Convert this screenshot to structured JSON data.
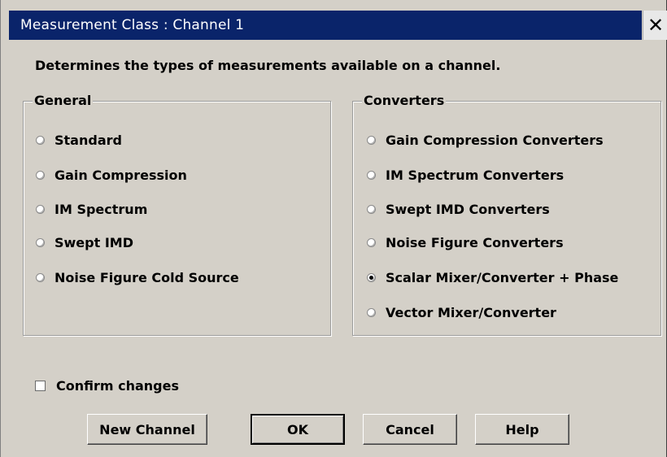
{
  "window": {
    "title": "Measurement Class : Channel 1",
    "close_glyph": "✕"
  },
  "description": "Determines the types of measurements available on a channel.",
  "groups": {
    "general": {
      "legend": "General",
      "options": [
        {
          "label": "Standard",
          "selected": false
        },
        {
          "label": "Gain Compression",
          "selected": false
        },
        {
          "label": "IM Spectrum",
          "selected": false
        },
        {
          "label": "Swept IMD",
          "selected": false
        },
        {
          "label": "Noise Figure Cold Source",
          "selected": false
        }
      ]
    },
    "converters": {
      "legend": "Converters",
      "options": [
        {
          "label": "Gain Compression Converters",
          "selected": false
        },
        {
          "label": "IM Spectrum Converters",
          "selected": false
        },
        {
          "label": "Swept IMD Converters",
          "selected": false
        },
        {
          "label": "Noise Figure Converters",
          "selected": false
        },
        {
          "label": "Scalar Mixer/Converter + Phase",
          "selected": true
        },
        {
          "label": "Vector Mixer/Converter",
          "selected": false
        }
      ]
    }
  },
  "confirm_changes": {
    "label": "Confirm changes",
    "checked": false
  },
  "buttons": {
    "new_channel": "New Channel",
    "ok": "OK",
    "cancel": "Cancel",
    "help": "Help"
  },
  "colors": {
    "titlebar_bg": "#0a246a",
    "dialog_bg": "#d4d0c8"
  }
}
